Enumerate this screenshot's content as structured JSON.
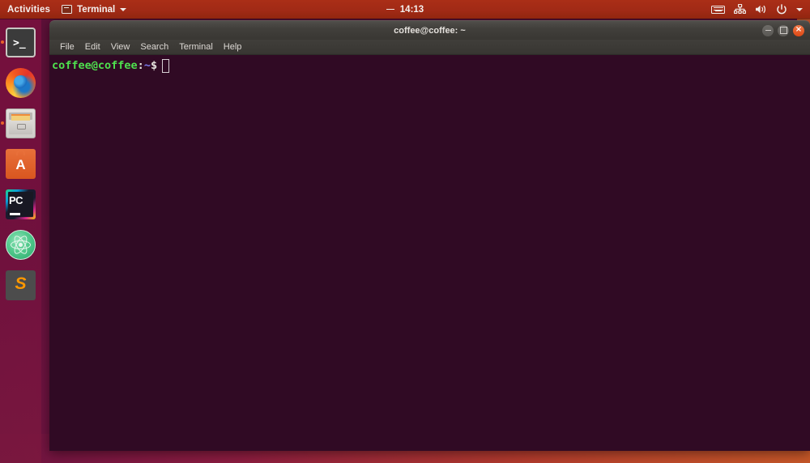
{
  "topbar": {
    "activities": "Activities",
    "app_menu": {
      "label": "Terminal",
      "icon": "terminal-window-icon"
    },
    "clock": "14:13",
    "tray": [
      {
        "name": "keyboard-layout-icon",
        "label": ""
      },
      {
        "name": "network-icon",
        "label": ""
      },
      {
        "name": "volume-icon",
        "label": ""
      },
      {
        "name": "power-icon",
        "label": ""
      },
      {
        "name": "chevron-down-icon",
        "label": ""
      }
    ]
  },
  "dock": {
    "items": [
      {
        "name": "terminal",
        "label": "Terminal",
        "running": true,
        "prompt": ">_"
      },
      {
        "name": "firefox",
        "label": "Firefox",
        "running": false
      },
      {
        "name": "files",
        "label": "Files",
        "running": true
      },
      {
        "name": "software",
        "label": "Ubuntu Software",
        "running": false,
        "glyph": "A"
      },
      {
        "name": "pycharm",
        "label": "PyCharm",
        "running": false,
        "glyph": "PC"
      },
      {
        "name": "atom",
        "label": "Atom",
        "running": false
      },
      {
        "name": "sublime",
        "label": "Sublime Text",
        "running": false,
        "glyph": "S"
      }
    ]
  },
  "terminal_window": {
    "title": "coffee@coffee: ~",
    "controls": {
      "minimize": "",
      "maximize": "",
      "close": "×"
    },
    "menu": [
      "File",
      "Edit",
      "View",
      "Search",
      "Terminal",
      "Help"
    ],
    "content": {
      "user_host": "coffee@coffee",
      "colon": ":",
      "path": "~",
      "sigil": "$",
      "command": ""
    }
  },
  "colors": {
    "topbar": "#a12a16",
    "dock": "#7a103e",
    "terminal_bg": "#300a24",
    "titlebar": "#3e3c38",
    "close_button": "#dd4814",
    "prompt_user": "#4ee04e",
    "prompt_path": "#7b7bef",
    "accent_orange": "#e8622a"
  }
}
